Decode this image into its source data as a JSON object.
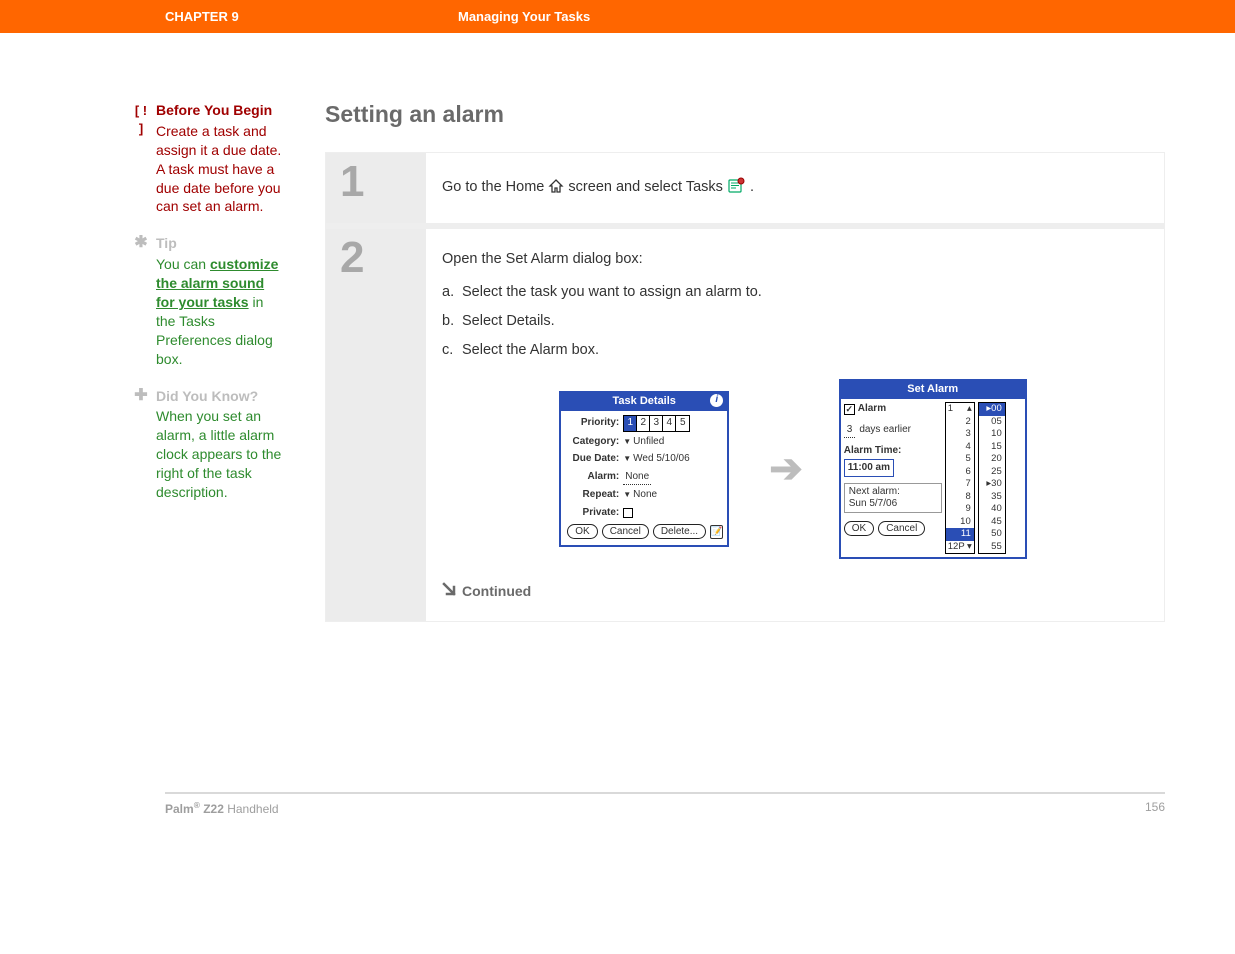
{
  "header": {
    "chapter": "CHAPTER 9",
    "title": "Managing Your Tasks"
  },
  "sidebar": {
    "beforeYouBegin": {
      "icon": "[ ! ]",
      "title": "Before You Begin",
      "text": "Create a task and assign it a due date. A task must have a due date before you can set an alarm."
    },
    "tip": {
      "icon": "✱",
      "title": "Tip",
      "pre": "You can ",
      "link": "customize the alarm sound for your tasks",
      "post": " in the Tasks Preferences dialog box."
    },
    "didYouKnow": {
      "icon": "✚",
      "title": "Did You Know?",
      "text": "When you set an alarm, a little alarm clock appears to the right of the task description."
    }
  },
  "main": {
    "sectionTitle": "Setting an alarm",
    "step1": {
      "num": "1",
      "pre": "Go to the Home ",
      "mid": " screen and select Tasks ",
      "post": "."
    },
    "step2": {
      "num": "2",
      "intro": "Open the Set Alarm dialog box:",
      "a": {
        "label": "a.",
        "text": "Select the task you want to assign an alarm to."
      },
      "b": {
        "label": "b.",
        "text": "Select Details."
      },
      "c": {
        "label": "c.",
        "text": "Select the Alarm box."
      }
    },
    "continued": "Continued"
  },
  "taskDetails": {
    "title": "Task Details",
    "priorityLabel": "Priority:",
    "priorities": {
      "p1": "1",
      "p2": "2",
      "p3": "3",
      "p4": "4",
      "p5": "5"
    },
    "categoryLabel": "Category:",
    "categoryValue": "Unfiled",
    "dueDateLabel": "Due Date:",
    "dueDateValue": "Wed 5/10/06",
    "alarmLabel": "Alarm:",
    "alarmValue": "None",
    "repeatLabel": "Repeat:",
    "repeatValue": "None",
    "privateLabel": "Private:",
    "ok": "OK",
    "cancel": "Cancel",
    "delete": "Delete..."
  },
  "setAlarm": {
    "title": "Set Alarm",
    "alarmLabel": "Alarm",
    "daysNum": "3",
    "daysText": "days earlier",
    "alarmTimeLabel": "Alarm Time:",
    "alarmTimeValue": "11:00 am",
    "nextAlarm1": "Next alarm:",
    "nextAlarm2": "Sun 5/7/06",
    "ok": "OK",
    "cancel": "Cancel",
    "hours": {
      "h1": "1",
      "h2": "2",
      "h3": "3",
      "h4": "4",
      "h5": "5",
      "h6": "6",
      "h7": "7",
      "h8": "8",
      "h9": "9",
      "h10": "10",
      "h11": "11",
      "h12": "12P"
    },
    "mins": {
      "m00": "00",
      "m05": "05",
      "m10": "10",
      "m15": "15",
      "m20": "20",
      "m25": "25",
      "m30": "30",
      "m35": "35",
      "m40": "40",
      "m45": "45",
      "m50": "50",
      "m55": "55"
    }
  },
  "footer": {
    "product_pre": "Palm",
    "product_sup": "®",
    "product_model": " Z22",
    "product_post": " Handheld",
    "page": "156"
  }
}
